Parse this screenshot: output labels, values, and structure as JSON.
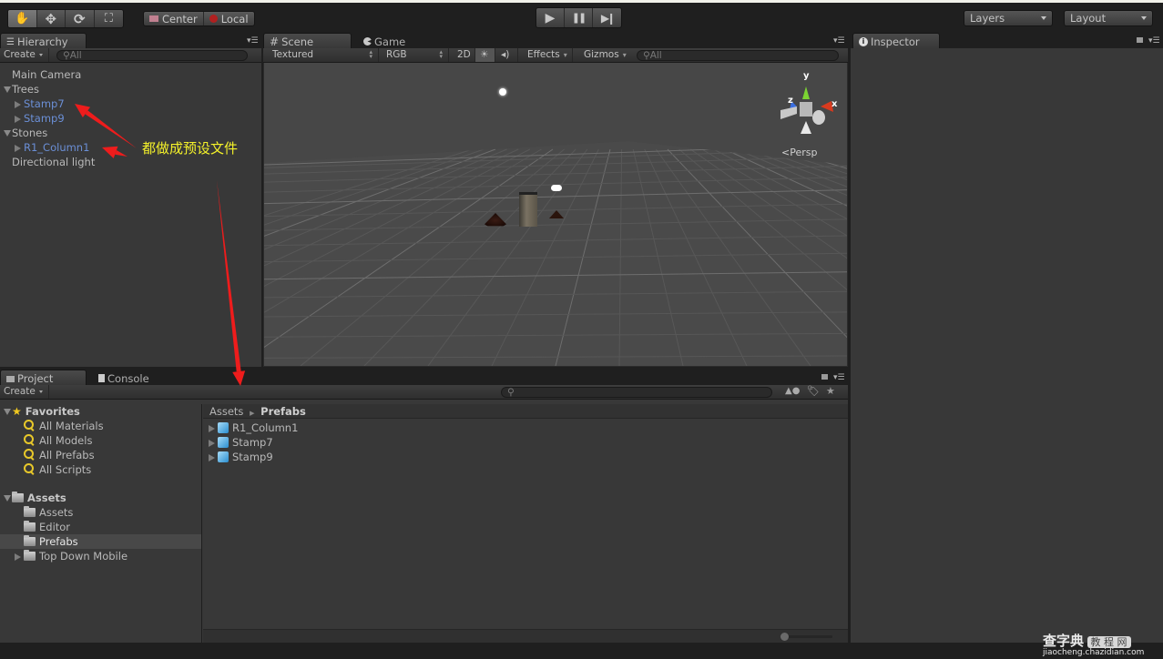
{
  "toolbar": {
    "tools": [
      {
        "name": "hand-tool",
        "icon": "hand-icon",
        "glyph": "✋",
        "active": true
      },
      {
        "name": "move-tool",
        "icon": "move-icon",
        "glyph": "✥",
        "active": false
      },
      {
        "name": "rotate-tool",
        "icon": "rotate-icon",
        "glyph": "⟳",
        "active": false
      },
      {
        "name": "scale-tool",
        "icon": "scale-icon",
        "glyph": "⛶",
        "active": false
      }
    ],
    "pivot_mode": "Center",
    "pivot_rotation": "Local",
    "play_glyph": "▶",
    "pause_glyph": "❚❚",
    "step_glyph": "▶❙",
    "layers_label": "Layers",
    "layout_label": "Layout"
  },
  "hierarchy": {
    "tab_label": "Hierarchy",
    "create_label": "Create",
    "search_placeholder": "All",
    "items": [
      {
        "label": "Main Camera",
        "depth": 0,
        "expander": "none",
        "prefab": false
      },
      {
        "label": "Trees",
        "depth": 0,
        "expander": "expanded",
        "prefab": false
      },
      {
        "label": "Stamp7",
        "depth": 1,
        "expander": "collapsed",
        "prefab": true
      },
      {
        "label": "Stamp9",
        "depth": 1,
        "expander": "collapsed",
        "prefab": true
      },
      {
        "label": "Stones",
        "depth": 0,
        "expander": "expanded",
        "prefab": false
      },
      {
        "label": "R1_Column1",
        "depth": 1,
        "expander": "collapsed",
        "prefab": true
      },
      {
        "label": "Directional light",
        "depth": 0,
        "expander": "none",
        "prefab": false
      }
    ]
  },
  "annotation": {
    "text": "都做成预设文件",
    "color": "#f5f22a",
    "arrow_color": "#ee1c1c"
  },
  "scene": {
    "tabs": [
      {
        "label": "Scene",
        "icon": "grid-icon",
        "active": true
      },
      {
        "label": "Game",
        "icon": "pacman-icon",
        "active": false
      }
    ],
    "render_mode": "Textured",
    "color_mode": "RGB",
    "two_d_label": "2D",
    "effects_label": "Effects",
    "gizmos_label": "Gizmos",
    "search_placeholder": "All",
    "gizmo_axes": {
      "x": "x",
      "y": "y",
      "z": "z"
    },
    "projection_label": "Persp"
  },
  "inspector": {
    "tab_label": "Inspector"
  },
  "project": {
    "tabs": [
      {
        "label": "Project",
        "active": true
      },
      {
        "label": "Console",
        "active": false
      }
    ],
    "create_label": "Create",
    "favorites": {
      "label": "Favorites",
      "items": [
        "All Materials",
        "All Models",
        "All Prefabs",
        "All Scripts"
      ]
    },
    "assets": {
      "label": "Assets",
      "items": [
        {
          "label": "Assets",
          "selected": false,
          "expandable": false
        },
        {
          "label": "Editor",
          "selected": false,
          "expandable": false
        },
        {
          "label": "Prefabs",
          "selected": true,
          "expandable": false
        },
        {
          "label": "Top Down Mobile",
          "selected": false,
          "expandable": true
        }
      ]
    },
    "breadcrumb": [
      "Assets",
      "Prefabs"
    ],
    "files": [
      "R1_Column1",
      "Stamp7",
      "Stamp9"
    ],
    "zoom_slider": 0
  },
  "watermark": {
    "brand": "查字典",
    "tag": "教 程 网",
    "url": "jiaocheng.chazidian.com"
  },
  "colors": {
    "prefab_text": "#6b8fd6",
    "selection": "#484848",
    "background": "#383838"
  }
}
